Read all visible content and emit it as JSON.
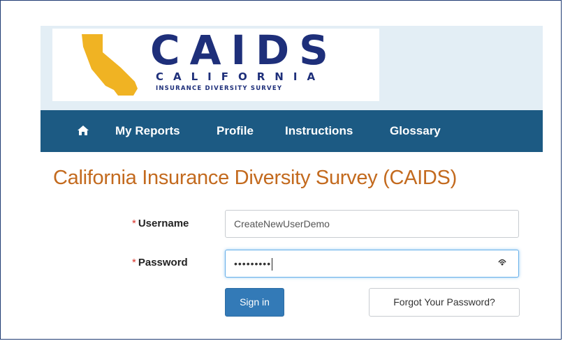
{
  "logo": {
    "title": "CAIDS",
    "state": "CALIFORNIA",
    "subtitle": "INSURANCE DIVERSITY SURVEY",
    "state_color": "#f0b323",
    "text_color": "#1e2f7a"
  },
  "nav": {
    "home_icon": "home-icon",
    "items": [
      {
        "label": "My Reports"
      },
      {
        "label": "Profile"
      },
      {
        "label": "Instructions"
      },
      {
        "label": "Glossary"
      }
    ],
    "background": "#1c5a83"
  },
  "page_title": "California Insurance Diversity Survey (CAIDS)",
  "form": {
    "required_mark": "*",
    "username": {
      "label": "Username",
      "value": "CreateNewUserDemo"
    },
    "password": {
      "label": "Password",
      "value_masked": "•••••••••",
      "reveal_icon": "eye-icon"
    },
    "sign_in_label": "Sign in",
    "forgot_label": "Forgot Your Password?"
  },
  "colors": {
    "title": "#c36a1e",
    "primary_button": "#337ab7",
    "required": "#d9342b"
  }
}
